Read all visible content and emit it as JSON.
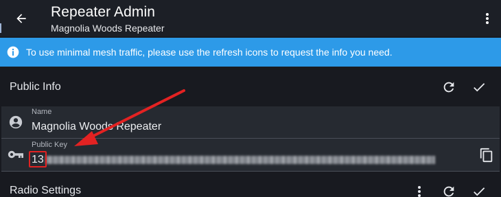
{
  "appbar": {
    "title": "Repeater Admin",
    "subtitle": "Magnolia Woods Repeater",
    "back_icon": "arrow-left-icon",
    "menu_icon": "more-vert-icon"
  },
  "banner": {
    "text": "To use minimal mesh traffic, please use the refresh icons to request the info you need.",
    "icon": "info-icon",
    "color": "#2d9ae8"
  },
  "public_info": {
    "title": "Public Info",
    "refresh_icon": "refresh-icon",
    "check_icon": "check-icon",
    "name": {
      "label": "Name",
      "value": "Magnolia Woods Repeater",
      "icon": "account-circle-icon"
    },
    "public_key": {
      "label": "Public Key",
      "value_prefix": "13",
      "icon": "key-icon",
      "copy_icon": "copy-icon"
    }
  },
  "radio_settings": {
    "title": "Radio Settings",
    "menu_icon": "more-vert-icon",
    "refresh_icon": "refresh-icon",
    "check_icon": "check-icon"
  },
  "annotation": {
    "color": "#e32222"
  }
}
